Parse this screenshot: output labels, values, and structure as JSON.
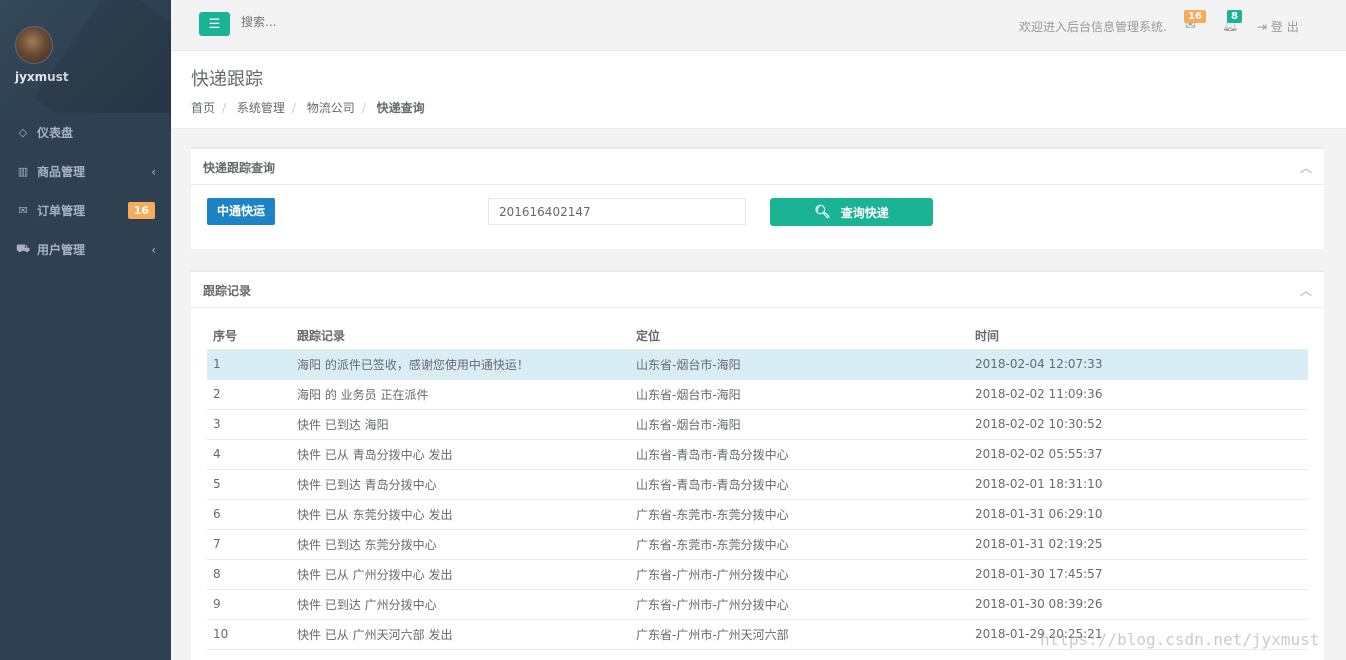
{
  "sidebar": {
    "username": "jyxmust",
    "items": [
      {
        "label": "仪表盘",
        "icon": "diamond-icon"
      },
      {
        "label": "商品管理",
        "icon": "bar-chart-icon"
      },
      {
        "label": "订单管理",
        "icon": "envelope-icon",
        "badge": "16"
      },
      {
        "label": "用户管理",
        "icon": "cart-icon"
      }
    ]
  },
  "topbar": {
    "search_placeholder": "搜索...",
    "welcome": "欢迎进入后台信息管理系统.",
    "mail_count": "16",
    "bell_count": "8",
    "logout": "登 出"
  },
  "heading": {
    "title": "快递跟踪",
    "breadcrumb": [
      "首页",
      "系统管理",
      "物流公司",
      "快递查询"
    ]
  },
  "query_panel": {
    "title": "快递跟踪查询",
    "carrier": "中通快运",
    "tracking_number": "201616402147",
    "submit": "查询快递"
  },
  "records_panel": {
    "title": "跟踪记录",
    "columns": [
      "序号",
      "跟踪记录",
      "定位",
      "时间"
    ],
    "rows": [
      {
        "no": "1",
        "record": "海阳 的派件已签收，感谢您使用中通快运！",
        "location": "山东省-烟台市-海阳",
        "time": "2018-02-04 12:07:33"
      },
      {
        "no": "2",
        "record": "海阳 的 业务员 正在派件",
        "location": "山东省-烟台市-海阳",
        "time": "2018-02-02 11:09:36"
      },
      {
        "no": "3",
        "record": "快件 已到达 海阳",
        "location": "山东省-烟台市-海阳",
        "time": "2018-02-02 10:30:52"
      },
      {
        "no": "4",
        "record": "快件 已从 青岛分拨中心 发出",
        "location": "山东省-青岛市-青岛分拨中心",
        "time": "2018-02-02 05:55:37"
      },
      {
        "no": "5",
        "record": "快件 已到达 青岛分拨中心",
        "location": "山东省-青岛市-青岛分拨中心",
        "time": "2018-02-01 18:31:10"
      },
      {
        "no": "6",
        "record": "快件 已从 东莞分拨中心 发出",
        "location": "广东省-东莞市-东莞分拨中心",
        "time": "2018-01-31 06:29:10"
      },
      {
        "no": "7",
        "record": "快件 已到达 东莞分拨中心",
        "location": "广东省-东莞市-东莞分拨中心",
        "time": "2018-01-31 02:19:25"
      },
      {
        "no": "8",
        "record": "快件 已从 广州分拨中心 发出",
        "location": "广东省-广州市-广州分拨中心",
        "time": "2018-01-30 17:45:57"
      },
      {
        "no": "9",
        "record": "快件 已到达 广州分拨中心",
        "location": "广东省-广州市-广州分拨中心",
        "time": "2018-01-30 08:39:26"
      },
      {
        "no": "10",
        "record": "快件 已从 广州天河六部 发出",
        "location": "广东省-广州市-广州天河六部",
        "time": "2018-01-29 20:25:21"
      }
    ]
  },
  "watermark": "https://blog.csdn.net/jyxmust"
}
